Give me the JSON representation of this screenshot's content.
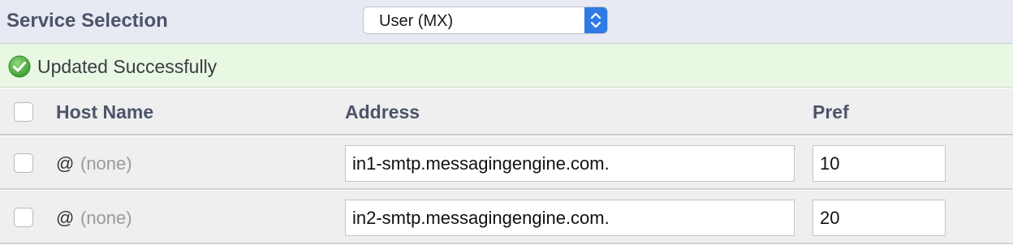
{
  "service_selection": {
    "title": "Service Selection",
    "selected": "User (MX)"
  },
  "status": {
    "message": "Updated Successfully",
    "color": "#4caf50"
  },
  "table": {
    "columns": {
      "host": "Host Name",
      "address": "Address",
      "pref": "Pref"
    },
    "rows": [
      {
        "host_at": "@",
        "host_name": "(none)",
        "address": "in1-smtp.messagingengine.com.",
        "pref": "10"
      },
      {
        "host_at": "@",
        "host_name": "(none)",
        "address": "in2-smtp.messagingengine.com.",
        "pref": "20"
      }
    ]
  },
  "colors": {
    "header_bg": "#e8eaf3",
    "banner_bg": "#e8f8e2",
    "select_accent": "#2f7ae5",
    "heading_text": "#4b5468"
  },
  "icons": {
    "select_arrows": "chevron-up-down-icon",
    "success": "check-circle-icon"
  }
}
